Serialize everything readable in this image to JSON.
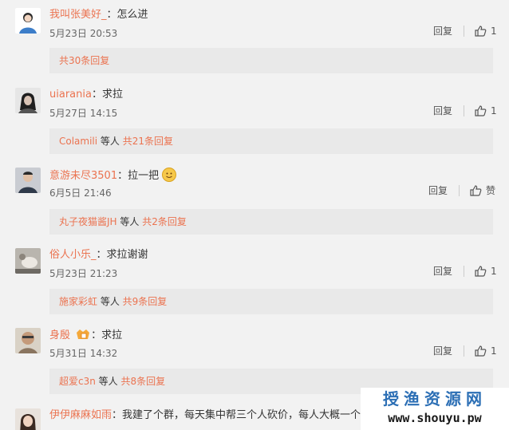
{
  "comments": [
    {
      "user": "我叫张美好_",
      "text": "怎么进",
      "time": "5月23日 20:53",
      "reply": "回复",
      "likes": "1",
      "sub_prefix": "",
      "sub_mid": "",
      "sub_count": "共30条回复"
    },
    {
      "user": "uiarania",
      "text": "求拉",
      "time": "5月27日 14:15",
      "reply": "回复",
      "likes": "1",
      "sub_prefix": "Colamili",
      "sub_mid": " 等人 ",
      "sub_count": "共21条回复"
    },
    {
      "user": "意游未尽3501",
      "text": "拉一把",
      "time": "6月5日 21:46",
      "reply": "回复",
      "likes": "赞",
      "sub_prefix": "丸子夜猫酱JH",
      "sub_mid": " 等人 ",
      "sub_count": "共2条回复"
    },
    {
      "user": "俗人小乐_",
      "text": "求拉谢谢",
      "time": "5月23日 21:23",
      "reply": "回复",
      "likes": "1",
      "sub_prefix": "施家彩虹",
      "sub_mid": " 等人 ",
      "sub_count": "共9条回复"
    },
    {
      "user": "身殷",
      "text": "求拉",
      "time": "5月31日 14:32",
      "reply": "回复",
      "likes": "1",
      "sub_prefix": "超爱c3n",
      "sub_mid": " 等人 ",
      "sub_count": "共8条回复"
    },
    {
      "user": "伊伊麻麻如雨",
      "text": "我建了个群，每天集中帮三个人砍价，每人大概一个月"
    }
  ],
  "watermark": {
    "cn": "授渔资源网",
    "url": "www.shouyu.pw"
  },
  "colors": {
    "accent": "#eb7350",
    "background": "#f2f2f2",
    "subbox": "#e9e9e9"
  }
}
